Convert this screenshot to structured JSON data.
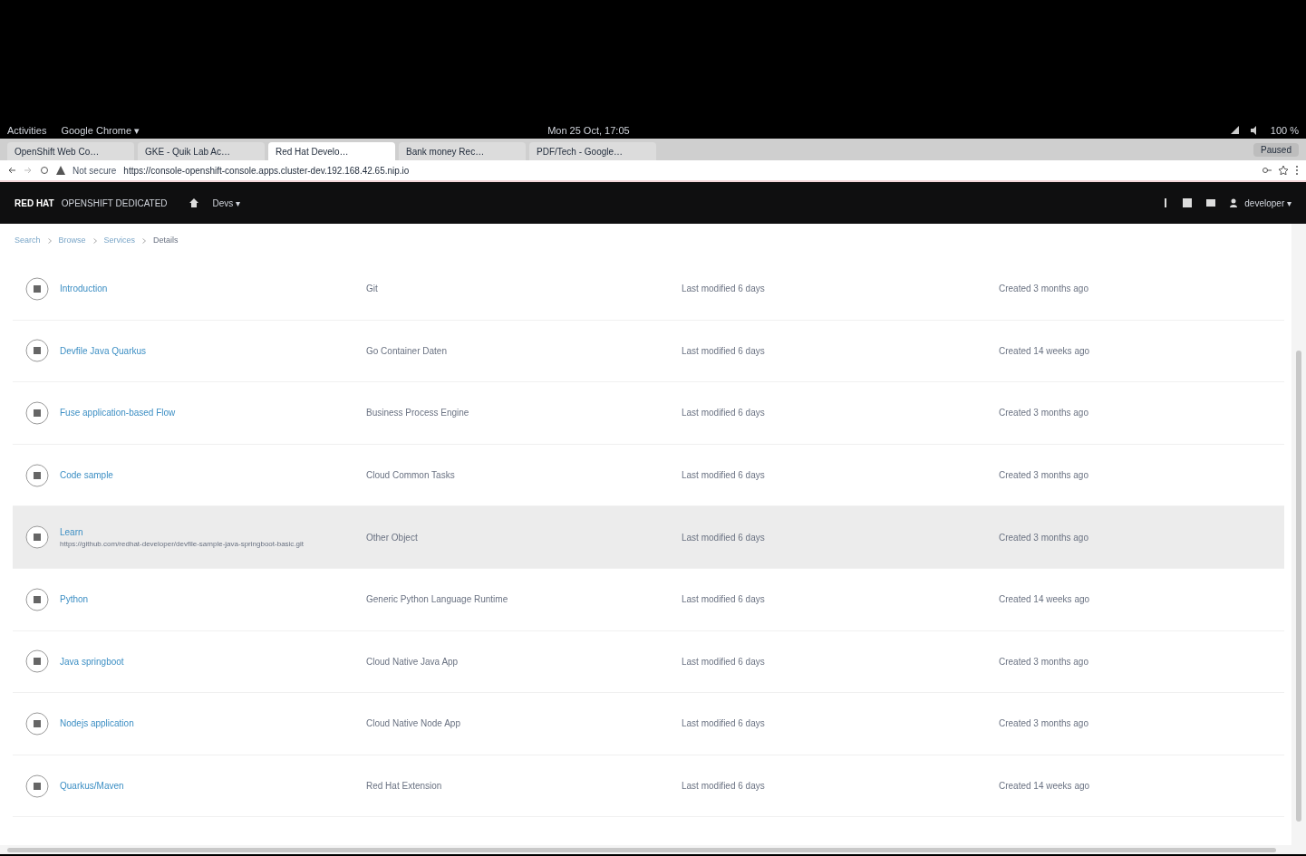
{
  "system_bar": {
    "activities": "Activities",
    "app_menu": "Google Chrome ▾",
    "clock": "Mon 25 Oct, 17:05",
    "battery": "100 %"
  },
  "browser": {
    "tabs": [
      {
        "title": "OpenShift Web Co…",
        "selected": false
      },
      {
        "title": "GKE - Quik Lab Ac…",
        "selected": false
      },
      {
        "title": "Red Hat Develo…",
        "selected": true
      },
      {
        "title": "Bank money Rec…",
        "selected": false
      },
      {
        "title": "PDF/Tech - Google…",
        "selected": false
      }
    ],
    "profile": "Paused",
    "address": {
      "security": "Not secure",
      "url": "https://console-openshift-console.apps.cluster-dev.192.168.42.65.nip.io"
    }
  },
  "masthead": {
    "brand": "RED HAT",
    "product": "OPENSHIFT DEDICATED",
    "perspective": "Devs ▾",
    "user": "developer ▾"
  },
  "breadcrumb": [
    "Search",
    "Browse",
    "Services",
    "Details"
  ],
  "rows": [
    {
      "name": "Introduction",
      "subtitle": "",
      "description": "Git",
      "modified": "Last modified 6 days",
      "created": "Created 3 months ago",
      "selected": false
    },
    {
      "name": "Devfile Java Quarkus",
      "subtitle": "",
      "description": "Go Container Daten",
      "modified": "Last modified 6 days",
      "created": "Created 14 weeks ago",
      "selected": false
    },
    {
      "name": "Fuse application-based Flow",
      "subtitle": "",
      "description": "Business Process Engine",
      "modified": "Last modified 6 days",
      "created": "Created 3 months ago",
      "selected": false
    },
    {
      "name": "Code sample",
      "subtitle": "",
      "description": "Cloud Common Tasks",
      "modified": "Last modified 6 days",
      "created": "Created 3 months ago",
      "selected": false
    },
    {
      "name": "Learn",
      "subtitle": "https://github.com/redhat-developer/devfile-sample-java-springboot-basic.git",
      "description": "Other Object",
      "modified": "Last modified 6 days",
      "created": "Created 3 months ago",
      "selected": true
    },
    {
      "name": "Python",
      "subtitle": "",
      "description": "Generic Python Language Runtime",
      "modified": "Last modified 6 days",
      "created": "Created 14 weeks ago",
      "selected": false
    },
    {
      "name": "Java springboot",
      "subtitle": "",
      "description": "Cloud Native Java App",
      "modified": "Last modified 6 days",
      "created": "Created 3 months ago",
      "selected": false
    },
    {
      "name": "Nodejs application",
      "subtitle": "",
      "description": "Cloud Native Node App",
      "modified": "Last modified 6 days",
      "created": "Created 3 months ago",
      "selected": false
    },
    {
      "name": "Quarkus/Maven",
      "subtitle": "",
      "description": "Red Hat Extension",
      "modified": "Last modified 6 days",
      "created": "Created 14 weeks ago",
      "selected": false
    }
  ]
}
